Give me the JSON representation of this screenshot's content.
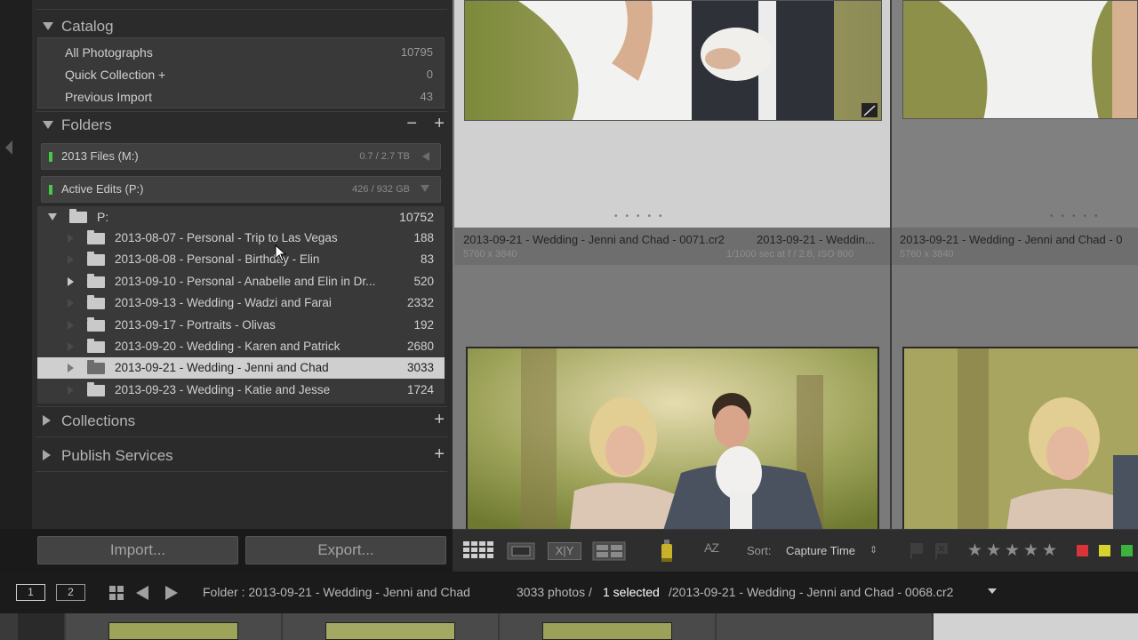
{
  "catalog": {
    "title": "Catalog",
    "rows": [
      {
        "label": "All Photographs",
        "count": "10795"
      },
      {
        "label": "Quick Collection +",
        "count": "0"
      },
      {
        "label": "Previous Import",
        "count": "43"
      }
    ]
  },
  "folders": {
    "title": "Folders",
    "minus": "−",
    "plus": "+",
    "volumes": [
      {
        "label": "2013 Files (M:)",
        "size": "0.7 / 2.7 TB"
      },
      {
        "label": "Active Edits (P:)",
        "size": "426 / 932 GB"
      }
    ],
    "root": {
      "label": "P:",
      "count": "10752"
    },
    "items": [
      {
        "label": "2013-08-07 - Personal - Trip to Las Vegas",
        "count": "188"
      },
      {
        "label": "2013-08-08 - Personal - Birthday - Elin",
        "count": "83"
      },
      {
        "label": "2013-09-10 - Personal - Anabelle and Elin in Dr...",
        "count": "520"
      },
      {
        "label": "2013-09-13 - Wedding - Wadzi and Farai",
        "count": "2332"
      },
      {
        "label": "2013-09-17 - Portraits - Olivas",
        "count": "192"
      },
      {
        "label": "2013-09-20 - Wedding - Karen and Patrick",
        "count": "2680"
      },
      {
        "label": "2013-09-21 - Wedding - Jenni and Chad",
        "count": "3033"
      },
      {
        "label": "2013-09-23 - Wedding - Katie and Jesse",
        "count": "1724"
      }
    ]
  },
  "collections": {
    "title": "Collections",
    "plus": "+"
  },
  "publish": {
    "title": "Publish Services",
    "plus": "+"
  },
  "buttons": {
    "import": "Import...",
    "export": "Export..."
  },
  "grid": {
    "cell1": {
      "name": "2013-09-21 - Wedding - Jenni and Chad - 0071.cr2",
      "name2": "2013-09-21 - Weddin...",
      "dims": "5760 x 3840",
      "exif": "1/1000 sec at f / 2.8, ISO 800"
    },
    "cell2": {
      "name": "2013-09-21 - Wedding - Jenni and Chad - 0",
      "dims": "5760 x 3840"
    }
  },
  "toolbar": {
    "sort_label": "Sort:",
    "sort_value": "Capture Time",
    "sort_arrows": "⇕",
    "xy": "X|Y",
    "az": "AZ"
  },
  "filmbar": {
    "monitor1": "1",
    "monitor2": "2",
    "folder_text": "Folder : 2013-09-21 - Wedding - Jenni and Chad",
    "photos": "3033 photos /",
    "selected": "1 selected",
    "filename": "/2013-09-21 - Wedding - Jenni and Chad - 0068.cr2"
  },
  "colors": {
    "label_red": "#d9343a",
    "label_yellow": "#d8d22c",
    "label_green": "#3db33d",
    "volume_ok": "#48c848"
  }
}
